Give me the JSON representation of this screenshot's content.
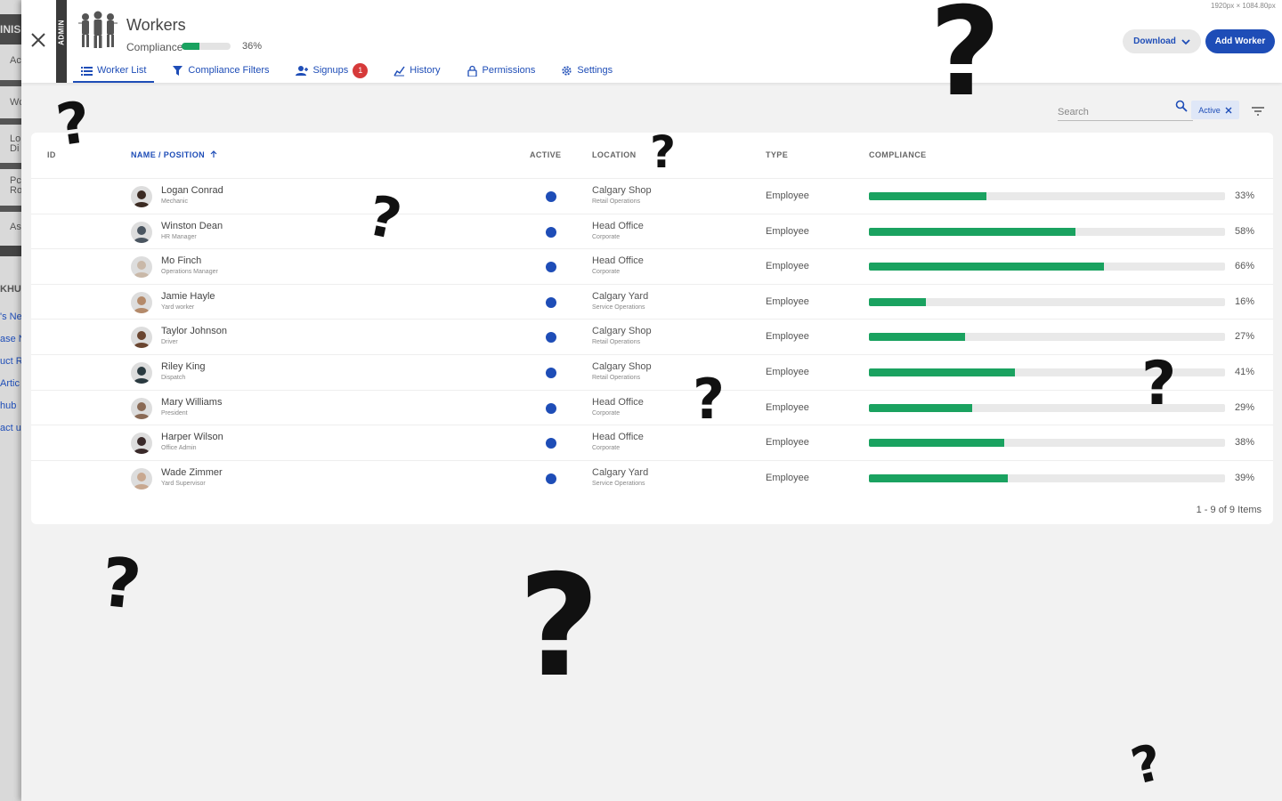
{
  "background_app": {
    "lines": [
      "INIS",
      "Ac",
      "Wc",
      "Lo",
      "Di",
      "Pc",
      "Ro",
      "As",
      "KHU",
      "'s Ne",
      "ase N",
      "uct R",
      "Artic",
      "hub",
      "act u"
    ]
  },
  "header": {
    "title": "Workers",
    "admin_label": "ADMIN",
    "compliance_label": "Compliance",
    "compliance_value": 0.36,
    "compliance_pct": "36%",
    "dimensions_note": "1920px × 1084.80px",
    "download_label": "Download",
    "add_label": "Add Worker"
  },
  "tabs": [
    {
      "label": "Worker List",
      "icon": "list-icon",
      "active": true
    },
    {
      "label": "Compliance Filters",
      "icon": "filter-icon"
    },
    {
      "label": "Signups",
      "icon": "add-user-icon",
      "badge": "1"
    },
    {
      "label": "History",
      "icon": "chart-icon"
    },
    {
      "label": "Permissions",
      "icon": "lock-icon"
    },
    {
      "label": "Settings",
      "icon": "gear-icon"
    }
  ],
  "search": {
    "placeholder": "Search"
  },
  "filter_chip": {
    "label": "Active"
  },
  "table": {
    "columns": {
      "id": "ID",
      "name": "NAME / POSITION",
      "active": "ACTIVE",
      "location": "LOCATION",
      "type": "TYPE",
      "compliance": "COMPLIANCE"
    },
    "rows": [
      {
        "name": "Logan Conrad",
        "position": "Mechanic",
        "location": "Calgary Shop",
        "location_sub": "Retail Operations",
        "type": "Employee",
        "compliance": 33,
        "pct": "33%"
      },
      {
        "name": "Winston Dean",
        "position": "HR Manager",
        "location": "Head Office",
        "location_sub": "Corporate",
        "type": "Employee",
        "compliance": 58,
        "pct": "58%"
      },
      {
        "name": "Mo Finch",
        "position": "Operations Manager",
        "location": "Head Office",
        "location_sub": "Corporate",
        "type": "Employee",
        "compliance": 66,
        "pct": "66%"
      },
      {
        "name": "Jamie Hayle",
        "position": "Yard worker",
        "location": "Calgary Yard",
        "location_sub": "Service Operations",
        "type": "Employee",
        "compliance": 16,
        "pct": "16%"
      },
      {
        "name": "Taylor Johnson",
        "position": "Driver",
        "location": "Calgary Shop",
        "location_sub": "Retail Operations",
        "type": "Employee",
        "compliance": 27,
        "pct": "27%"
      },
      {
        "name": "Riley King",
        "position": "Dispatch",
        "location": "Calgary Shop",
        "location_sub": "Retail Operations",
        "type": "Employee",
        "compliance": 41,
        "pct": "41%"
      },
      {
        "name": "Mary Williams",
        "position": "President",
        "location": "Head Office",
        "location_sub": "Corporate",
        "type": "Employee",
        "compliance": 29,
        "pct": "29%"
      },
      {
        "name": "Harper Wilson",
        "position": "Office Admin",
        "location": "Head Office",
        "location_sub": "Corporate",
        "type": "Employee",
        "compliance": 38,
        "pct": "38%"
      },
      {
        "name": "Wade Zimmer",
        "position": "Yard Supervisor",
        "location": "Calgary Yard",
        "location_sub": "Service Operations",
        "type": "Employee",
        "compliance": 39,
        "pct": "39%"
      }
    ],
    "footer": "1 - 9 of 9 Items"
  },
  "colors": {
    "accent": "#1e4db7",
    "success": "#1aa260",
    "badge": "#d63a3a"
  },
  "avatar_colors": [
    "#3b2a22",
    "#4a5560",
    "#c9b8a8",
    "#b48a6a",
    "#6a4530",
    "#2a3a40",
    "#8a6a55",
    "#3a2a2a",
    "#c8a890"
  ],
  "overlay_marks": [
    "?",
    "?",
    "?",
    "?",
    "?",
    "?",
    "?",
    "?",
    "?"
  ]
}
